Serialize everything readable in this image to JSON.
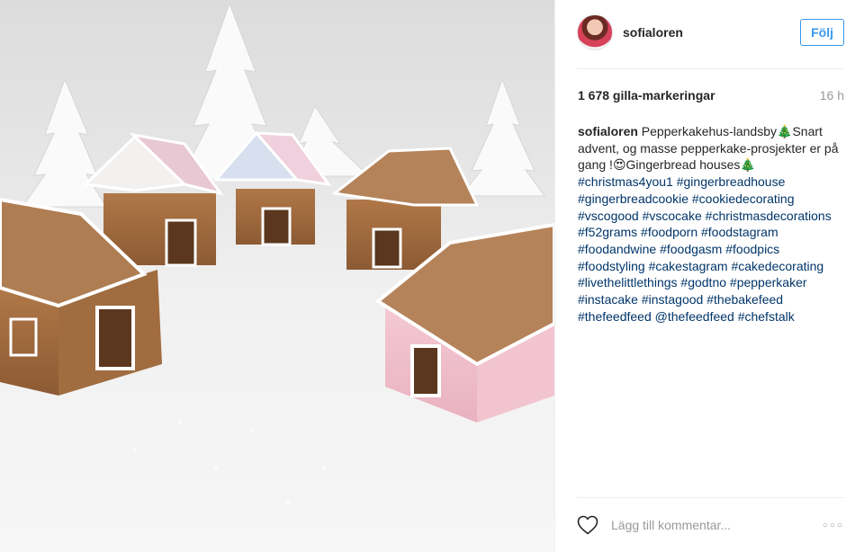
{
  "post": {
    "username": "sofialoren",
    "follow_label": "Följ",
    "likes": "1 678 gilla-markeringar",
    "time": "16 h"
  },
  "caption": {
    "username": "sofialoren",
    "text_1": "Pepperkakehus-landsby",
    "emoji_tree": "🎄",
    "text_2": "Snart advent, og masse pepperkake-prosjekter er på gang !",
    "emoji_smile": "😍",
    "text_3": "Gingerbread houses",
    "hashtags": [
      "#christmas4you1",
      "#gingerbreadhouse",
      "#gingerbreadcookie",
      "#cookiedecorating",
      "#vscogood",
      "#vscocake",
      "#christmasdecorations",
      "#f52grams",
      "#foodporn",
      "#foodstagram",
      "#foodandwine",
      "#foodgasm",
      "#foodpics",
      "#foodstyling",
      "#cakestagram",
      "#cakedecorating",
      "#livethelittlethings",
      "#godtno",
      "#pepperkaker",
      "#instacake",
      "#instagood",
      "#thebakefeed",
      "#thefeedfeed",
      "@thefeedfeed",
      "#chefstalk"
    ]
  },
  "comment": {
    "placeholder": "Lägg till kommentar..."
  },
  "icons": {
    "heart": "heart-icon",
    "more": "more-icon"
  },
  "colors": {
    "link": "#003569",
    "follow": "#3897f0",
    "muted": "#999999"
  }
}
